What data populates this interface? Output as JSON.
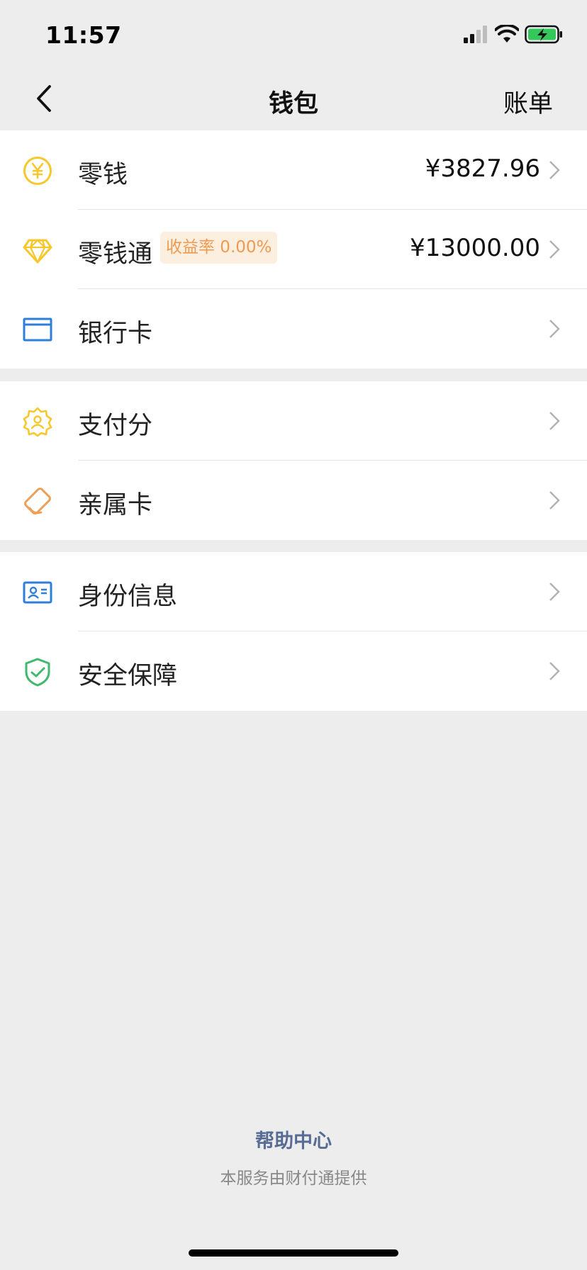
{
  "status_bar": {
    "time": "11:57"
  },
  "nav": {
    "title": "钱包",
    "right_action": "账单"
  },
  "groups": [
    {
      "rows": [
        {
          "label": "零钱",
          "value": "¥3827.96",
          "icon": "yuan-coin-icon"
        },
        {
          "label": "零钱通",
          "badge": "收益率 0.00%",
          "value": "¥13000.00",
          "icon": "diamond-icon"
        },
        {
          "label": "银行卡",
          "icon": "bank-card-icon"
        }
      ]
    },
    {
      "rows": [
        {
          "label": "支付分",
          "icon": "payscore-badge-icon"
        },
        {
          "label": "亲属卡",
          "icon": "family-card-icon"
        }
      ]
    },
    {
      "rows": [
        {
          "label": "身份信息",
          "icon": "id-card-icon"
        },
        {
          "label": "安全保障",
          "icon": "shield-check-icon"
        }
      ]
    }
  ],
  "footer": {
    "help": "帮助中心",
    "provider": "本服务由财付通提供"
  },
  "colors": {
    "background": "#ededed",
    "link": "#576b95",
    "yellow_icon": "#f7c72c",
    "orange_icon": "#eea05a",
    "blue_icon": "#2f7fd8",
    "green_icon": "#3fb96d",
    "badge_bg": "#fdefe0",
    "badge_text": "#ee9a50"
  }
}
